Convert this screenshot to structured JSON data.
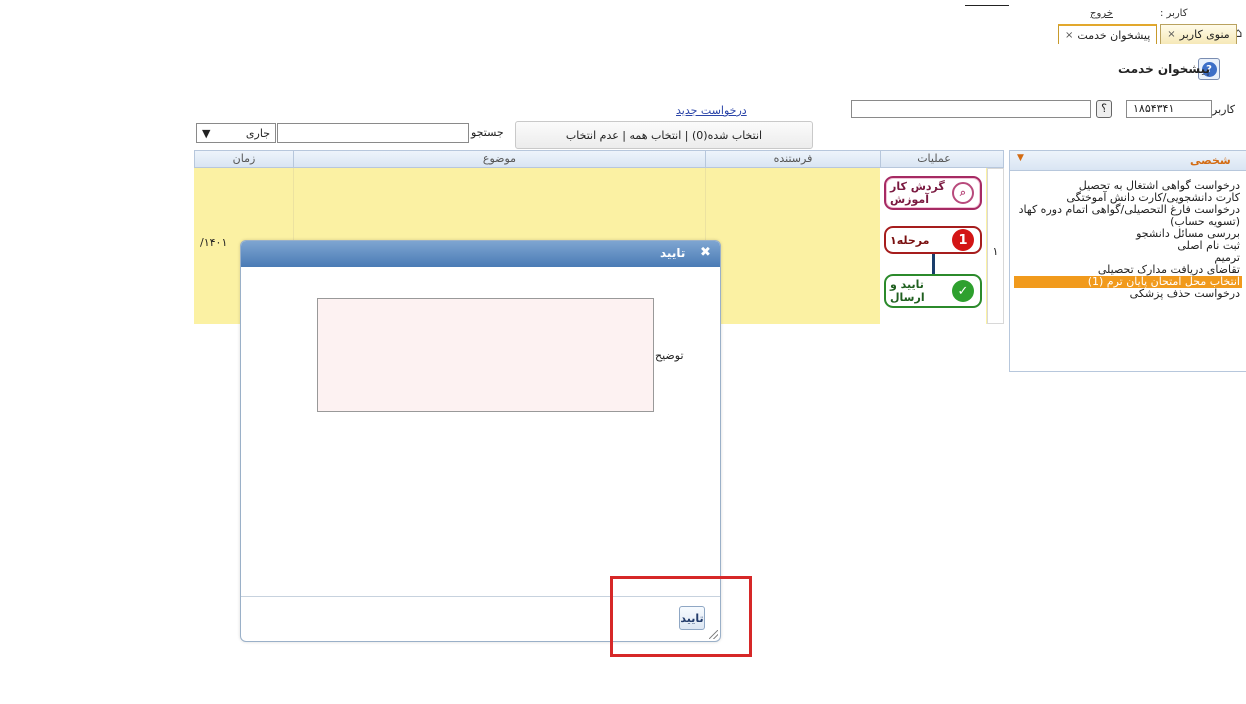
{
  "header": {
    "user_label": "کاربر :",
    "exit_label": "خروج"
  },
  "tabs": [
    {
      "label": "منوی کاربر",
      "close": "×"
    },
    {
      "label": "پیشخوان خدمت",
      "close": "×"
    }
  ],
  "page": {
    "title": "پیشخوان خدمت",
    "help_icon": "?"
  },
  "user_row": {
    "label": "کاربر",
    "user_id": "۱۸۵۴۳۴۱",
    "lookup_button": "؟",
    "new_request_link": "درخواست جدید"
  },
  "toolbar": {
    "selection_text": "انتخاب شده(0) | انتخاب همه | عدم انتخاب",
    "search_label": "جستجو",
    "search_value": "",
    "status_selected": "جاری",
    "status_caret": "▼"
  },
  "table": {
    "columns": [
      "عملیات",
      "فرستنده",
      "موضوع",
      "زمان"
    ],
    "rows": [
      {
        "num": "۱",
        "time": "۱۴۰۱/",
        "operations": {
          "rotate_label": "گردش کار آموزش",
          "step_label": "مرحله۱",
          "step_number": "1",
          "send_label": "تایید و ارسال"
        }
      }
    ]
  },
  "sidebar": {
    "title": "شخصی",
    "caret": "▼",
    "items": [
      "درخواست گواهی اشتغال به تحصیل",
      "کارت دانشجویی/کارت دانش آموختگی",
      "درخواست فارغ التحصیلی/گواهی اتمام دوره کهاد (تسویه حساب)",
      "بررسی مسائل دانشجو",
      "ثبت نام اصلی",
      "ترمیم",
      "تقاضای دریافت مدارک تحصیلی",
      "انتخاب محل امتحان پایان ترم (1)",
      "درخواست حذف پزشکی"
    ],
    "selected_index": 7
  },
  "modal": {
    "title": "تایید",
    "close": "✖",
    "description_label": "توضیح",
    "description_value": "",
    "confirm_button": "تایید"
  },
  "colors": {
    "row_highlight": "#fbf1a3",
    "modal_header": "#4a7bb5",
    "sidebar_selected": "#f19a1c",
    "annotation_box": "#d62828"
  }
}
